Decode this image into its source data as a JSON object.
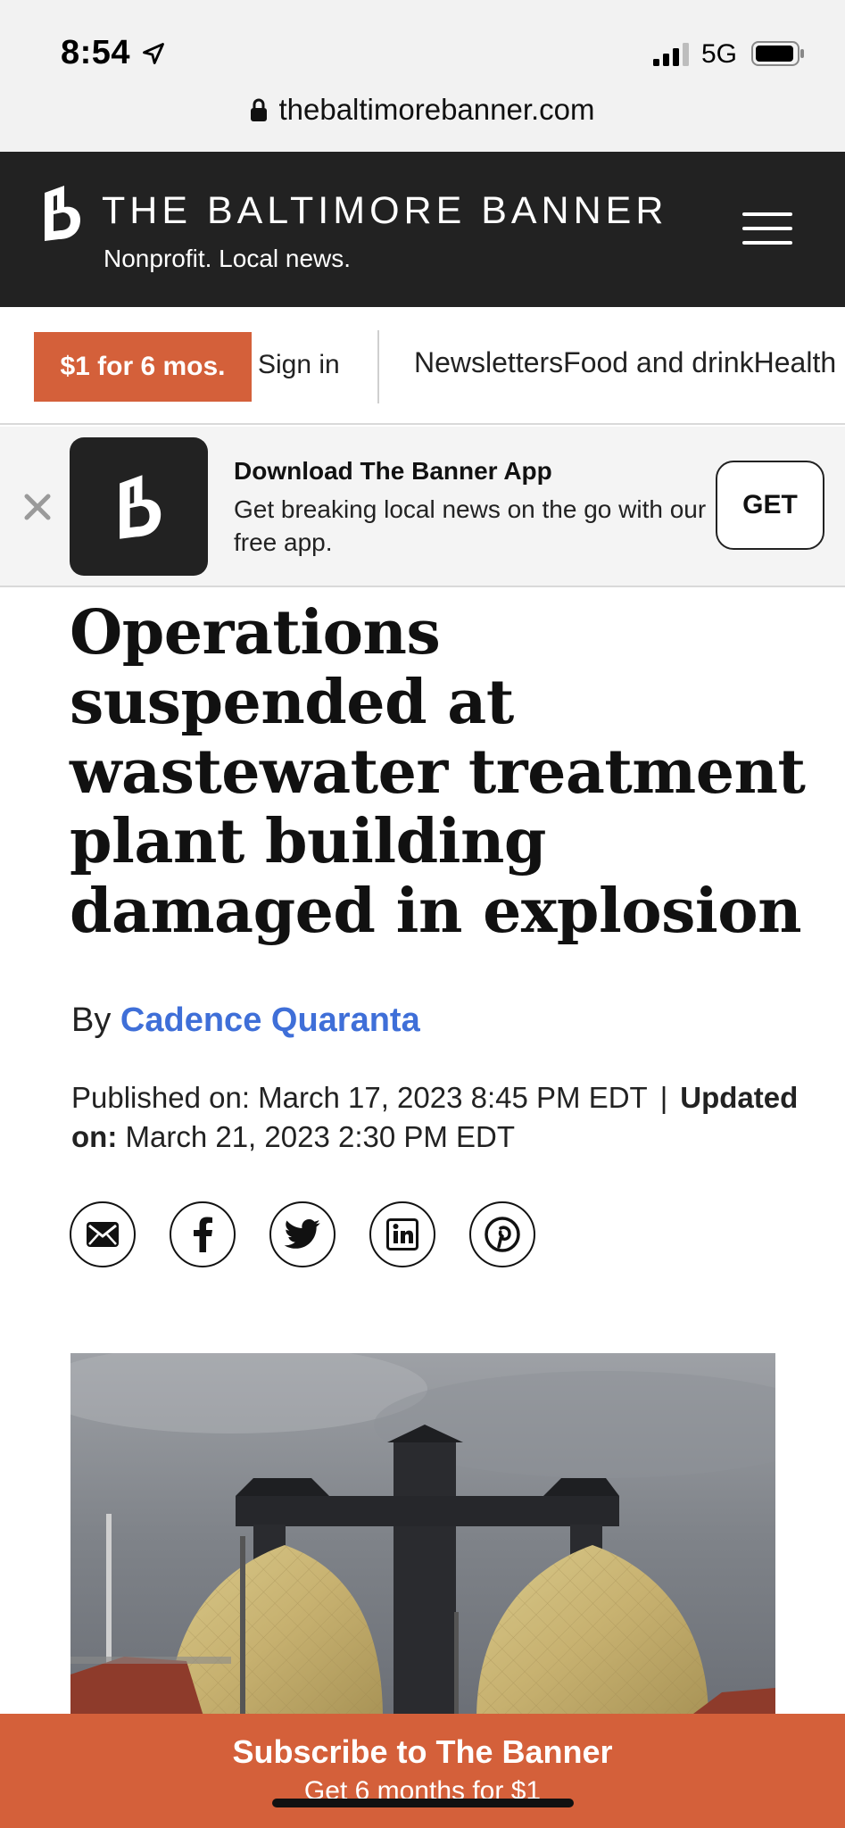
{
  "status_bar": {
    "time": "8:54",
    "network": "5G",
    "url": "thebaltimorebanner.com"
  },
  "header": {
    "brand_name": "THE BALTIMORE BANNER",
    "tagline": "Nonprofit. Local news."
  },
  "nav": {
    "promo_label": "$1 for 6 mos.",
    "signin_label": "Sign in",
    "links": [
      "Newsletters",
      "Food and drink",
      "Health"
    ]
  },
  "app_banner": {
    "title": "Download The Banner App",
    "description": "Get breaking local news on the go with our free app.",
    "get_label": "GET"
  },
  "article": {
    "headline": "Operations suspended at wastewater treatment plant building damaged in explosion",
    "by_prefix": "By",
    "author": "Cadence Quaranta",
    "published_label": "Published on:",
    "published_date": "March 17, 2023 8:45 PM EDT",
    "separator": "|",
    "updated_label": "Updated on:",
    "updated_date": "March 21, 2023 2:30 PM EDT",
    "share_icons": [
      "email-icon",
      "facebook-icon",
      "twitter-icon",
      "linkedin-icon",
      "pinterest-icon"
    ]
  },
  "subscribe_bar": {
    "title": "Subscribe to The Banner",
    "subtitle": "Get 6 months for $1"
  },
  "colors": {
    "accent": "#d4603a",
    "header_bg": "#222222",
    "link": "#3f6fd8"
  }
}
